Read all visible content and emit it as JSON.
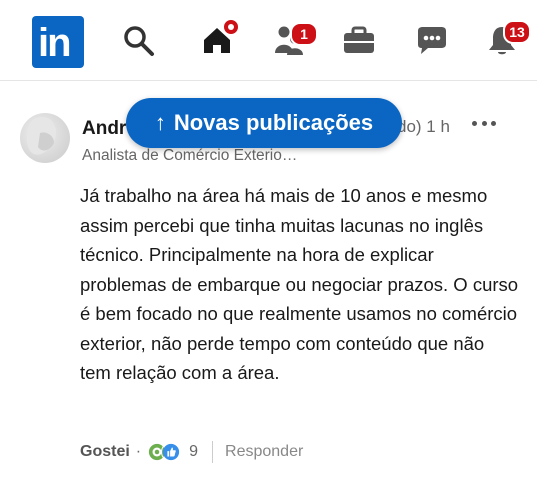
{
  "nav": {
    "logo_text": "in",
    "items": [
      {
        "name": "search",
        "badge": ""
      },
      {
        "name": "home",
        "badge": ""
      },
      {
        "name": "my-network",
        "badge": "1"
      },
      {
        "name": "jobs",
        "badge": ""
      },
      {
        "name": "messaging",
        "badge": ""
      },
      {
        "name": "notifications",
        "badge": "13"
      }
    ],
    "accent": "#0a66c2",
    "badge_color": "#cc1016"
  },
  "banner": {
    "label": "Novas publicações",
    "arrow": "↑"
  },
  "comment": {
    "author": "Andr",
    "meta": "do) 1 h",
    "more": "•••",
    "headline": "Analista de Comércio Exterio…",
    "body": "Já trabalho na área há mais de 10 anos e mesmo assim percebi que tinha muitas lacunas no inglês técnico. Principalmente na hora de explicar problemas de embarque ou negociar prazos. O curso é bem focado no que realmente usamos no comércio exterior, não perde tempo com conteúdo que não tem relação com a área.",
    "actions": {
      "like_label": "Gostei",
      "dot": "·",
      "reaction_count": "9",
      "reply_label": "Responder"
    }
  }
}
